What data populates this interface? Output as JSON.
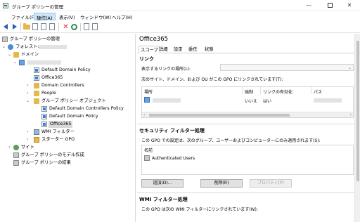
{
  "window": {
    "title": "グループ ポリシーの管理",
    "min_glyph": "—",
    "close_glyph": "✕"
  },
  "menu": {
    "file": "ファイル(F)",
    "action": "操作(A)",
    "view": "表示(V)",
    "window": "ウィンドウ(W)",
    "help": "ヘルプ(H)"
  },
  "tree": {
    "root": "グループ ポリシーの管理",
    "forest": "フォレスト:",
    "domains": "ドメイン",
    "ddp": "Default Domain Policy",
    "office365": "Office365",
    "dc": "Domain Controllers",
    "people": "People",
    "gpo_objects": "グループ ポリシー オブジェクト",
    "ddcp": "Default Domain Controllers Policy",
    "ddp2": "Default Domain Policy",
    "office365_sel": "Office365",
    "wmi": "WMI フィルター",
    "starter": "スターター GPO",
    "sites": "サイト",
    "modeling": "グループ ポリシーのモデル作成",
    "results": "グループ ポリシーの結果"
  },
  "detail": {
    "title": "Office365",
    "tabs": [
      "スコープ",
      "詳細",
      "設定",
      "委任",
      "状態"
    ],
    "links": {
      "heading": "リンク",
      "location_label": "表示するリンクの場所(L):",
      "linked_note": "次のサイト、ドメイン、および OU がこの GPO にリンクされています(T):",
      "columns": [
        "場所",
        "強制",
        "リンクの有効化",
        "パス"
      ],
      "row": {
        "enforced": "いいえ",
        "enabled": "はい"
      }
    },
    "security": {
      "heading": "セキュリティ フィルター処理",
      "note": "この GPO での設定は、次のグループ、ユーザーおよびコンピューターにのみ適用されます(S):",
      "column": "名前",
      "entries": [
        "Authenticated Users"
      ],
      "add": "追加(D)...",
      "remove": "削除(R)",
      "properties": "プロパティ(P)"
    },
    "wmi": {
      "heading": "WMI フィルター処理",
      "note": "この GPO は次の WMI フィルターにリンクされています(W):"
    }
  }
}
